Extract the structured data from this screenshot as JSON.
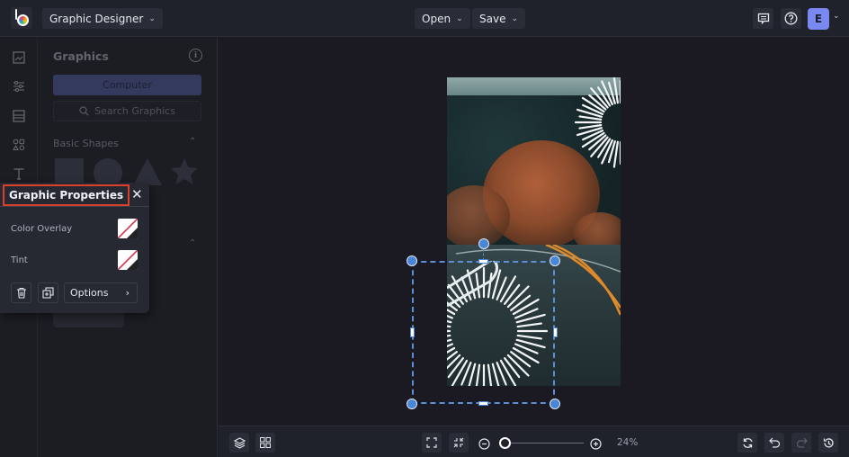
{
  "topbar": {
    "app_menu_label": "Graphic Designer",
    "open_label": "Open",
    "save_label": "Save",
    "user_initial": "E",
    "icons": [
      "comment-icon",
      "help-icon"
    ]
  },
  "rail": {
    "items": [
      "image-icon",
      "adjustments-icon",
      "layout-icon",
      "graphics-icon",
      "text-icon"
    ]
  },
  "panel": {
    "title": "Graphics",
    "computer_button": "Computer",
    "search_placeholder": "Search Graphics",
    "section_title": "Basic Shapes"
  },
  "properties": {
    "title": "Graphic Properties",
    "color_overlay_label": "Color Overlay",
    "tint_label": "Tint",
    "options_label": "Options"
  },
  "bottombar": {
    "zoom_percent": "24%",
    "zoom_level": 0.24
  },
  "colors": {
    "accent": "#6272c8",
    "highlight": "#d9412b",
    "selection": "#4a86d6",
    "avatar": "#7a88f2"
  }
}
